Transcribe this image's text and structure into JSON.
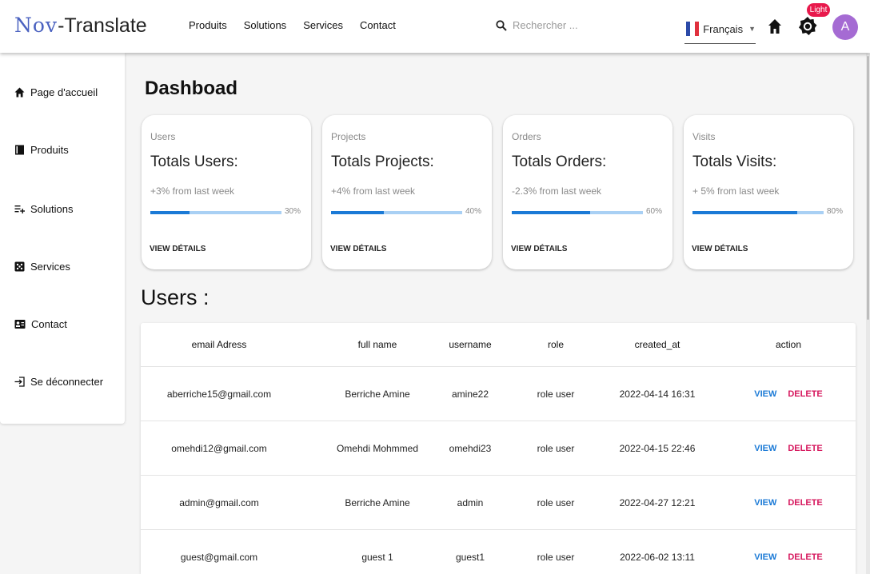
{
  "header": {
    "logo_part1": "Nov",
    "logo_part2": "-Translate",
    "nav": [
      "Produits",
      "Solutions",
      "Services",
      "Contact"
    ],
    "search_placeholder": "Rechercher ...",
    "language": "Français",
    "theme_badge": "Light",
    "avatar_initial": "A"
  },
  "sidebar": {
    "items": [
      {
        "label": "Page d'accueil",
        "icon": "home-icon"
      },
      {
        "label": "Produits",
        "icon": "book-icon"
      },
      {
        "label": "Solutions",
        "icon": "playlist-add-icon"
      },
      {
        "label": "Services",
        "icon": "dice-icon"
      },
      {
        "label": "Contact",
        "icon": "contact-card-icon"
      },
      {
        "label": "Se déconnecter",
        "icon": "logout-icon"
      }
    ]
  },
  "main": {
    "title": "Dashboad",
    "cards": [
      {
        "label": "Users",
        "title": "Totals Users:",
        "subtitle": "+3% from last week",
        "progress_label": "30%",
        "progress_fraction": 0.3,
        "button": "VIEW DÉTAILS"
      },
      {
        "label": "Projects",
        "title": "Totals Projects:",
        "subtitle": "+4% from last week",
        "progress_label": "40%",
        "progress_fraction": 0.4,
        "button": "VIEW DÉTAILS"
      },
      {
        "label": "Orders",
        "title": "Totals Orders:",
        "subtitle": "-2.3% from last week",
        "progress_label": "60%",
        "progress_fraction": 0.6,
        "button": "VIEW DÉTAILS"
      },
      {
        "label": "Visits",
        "title": "Totals Visits:",
        "subtitle": "+ 5% from last week",
        "progress_label": "80%",
        "progress_fraction": 0.8,
        "button": "VIEW DÉTAILS"
      }
    ],
    "users_title": "Users :",
    "table": {
      "columns": [
        "email Adress",
        "full name",
        "username",
        "role",
        "created_at",
        "action"
      ],
      "rows": [
        {
          "email": "aberriche15@gmail.com",
          "full_name": "Berriche Amine",
          "username": "amine22",
          "role": "role user",
          "created_at": "2022-04-14 16:31",
          "view": "VIEW",
          "delete": "DELETE"
        },
        {
          "email": "omehdi12@gmail.com",
          "full_name": "Omehdi Mohmmed",
          "username": "omehdi23",
          "role": "role user",
          "created_at": "2022-04-15 22:46",
          "view": "VIEW",
          "delete": "DELETE"
        },
        {
          "email": "admin@gmail.com",
          "full_name": "Berriche Amine",
          "username": "admin",
          "role": "role user",
          "created_at": "2022-04-27 12:21",
          "view": "VIEW",
          "delete": "DELETE"
        },
        {
          "email": "guest@gmail.com",
          "full_name": "guest 1",
          "username": "guest1",
          "role": "role user",
          "created_at": "2022-06-02 13:11",
          "view": "VIEW",
          "delete": "DELETE"
        }
      ]
    }
  },
  "colors": {
    "accent_blue": "#1b7ad6",
    "progress_track": "#a9d0f4",
    "delete_pink": "#d6175d",
    "badge_red": "#e8194c",
    "avatar_purple": "#a56bd3",
    "logo_blue": "#4b62c0"
  }
}
